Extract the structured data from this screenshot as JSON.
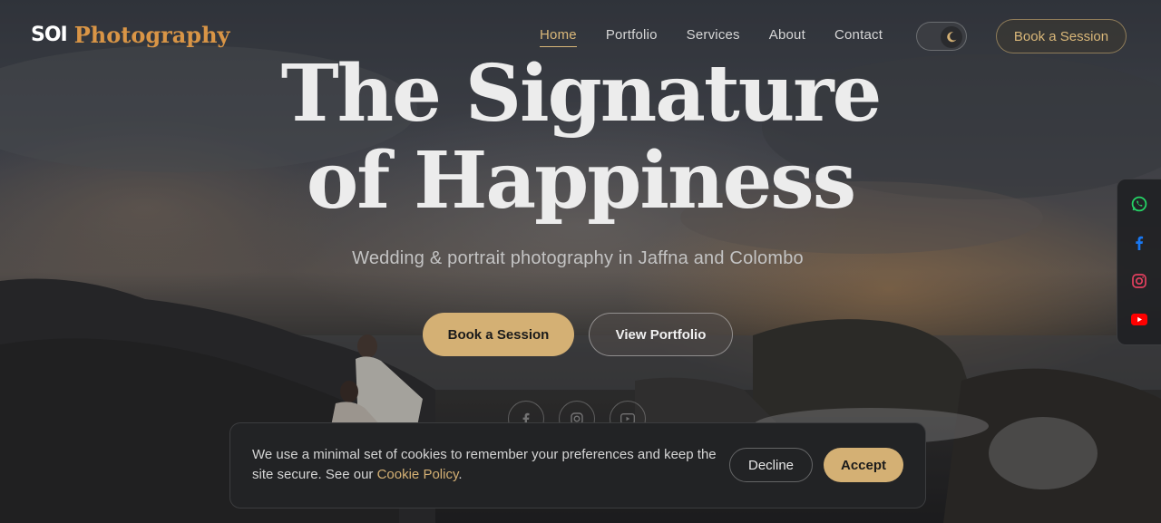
{
  "brand": {
    "logo_mark": "SOI",
    "name": "Photography"
  },
  "nav": {
    "items": [
      {
        "label": "Home",
        "active": true
      },
      {
        "label": "Portfolio",
        "active": false
      },
      {
        "label": "Services",
        "active": false
      },
      {
        "label": "About",
        "active": false
      },
      {
        "label": "Contact",
        "active": false
      }
    ],
    "theme_toggle_icon": "moon-icon",
    "book_label": "Book a Session"
  },
  "hero": {
    "title_line1": "The Signature",
    "title_line2": "of Happiness",
    "subtitle": "Wedding & portrait photography in Jaffna and Colombo",
    "primary_button": "Book a Session",
    "secondary_button": "View Portfolio",
    "social_icons": [
      "facebook-icon",
      "instagram-icon",
      "youtube-icon"
    ]
  },
  "social_rail": {
    "items": [
      {
        "icon": "whatsapp-icon",
        "color": "#25D366"
      },
      {
        "icon": "facebook-icon",
        "color": "#1877F2"
      },
      {
        "icon": "instagram-icon",
        "color": "#E4405F"
      },
      {
        "icon": "youtube-icon",
        "color": "#FF0000"
      }
    ]
  },
  "cookie": {
    "text_before": "We use a minimal set of cookies to remember your preferences and keep the site secure. See our ",
    "link": "Cookie Policy",
    "text_after": ".",
    "decline": "Decline",
    "accept": "Accept"
  },
  "colors": {
    "accent": "#D4B074",
    "logo_text": "#D99546",
    "banner_bg": "#222325"
  }
}
